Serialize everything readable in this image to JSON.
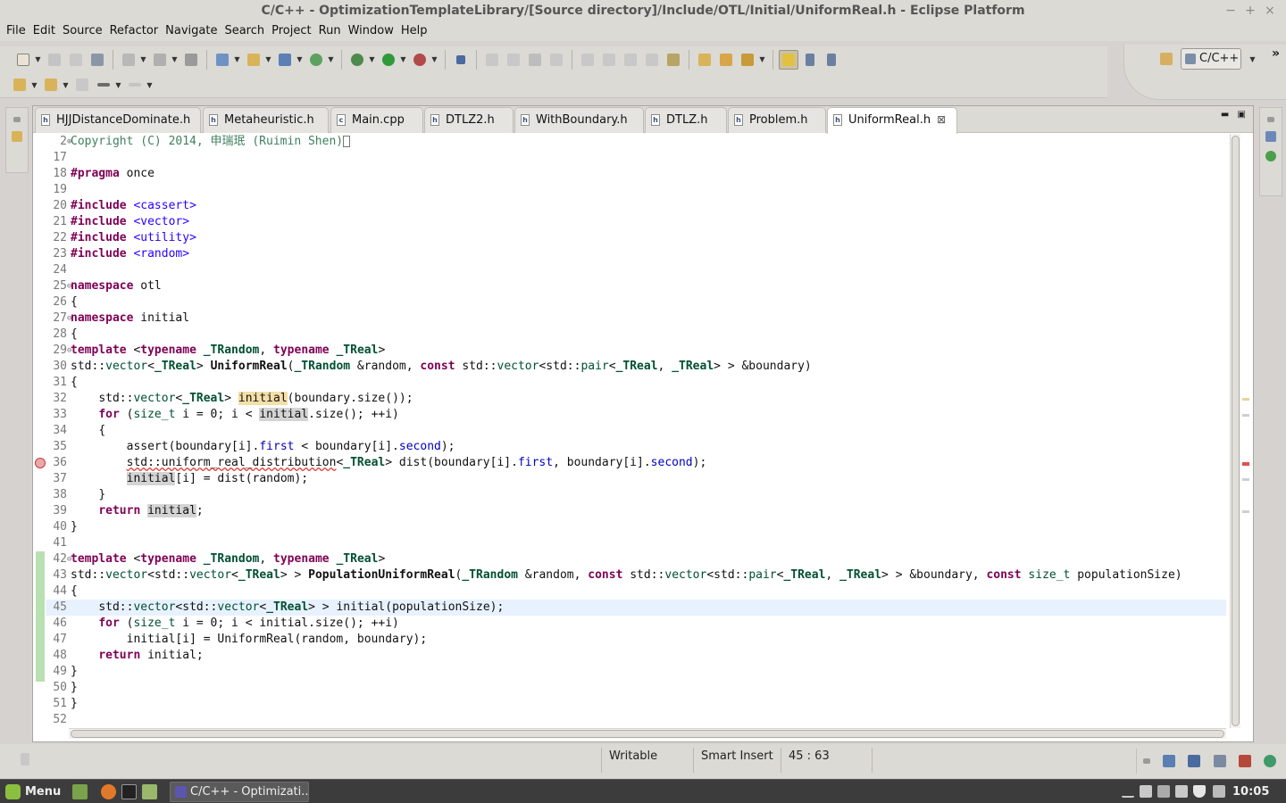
{
  "window": {
    "title": "C/C++ - OptimizationTemplateLibrary/[Source directory]/Include/OTL/Initial/UniformReal.h - Eclipse Platform"
  },
  "menubar": [
    "File",
    "Edit",
    "Source",
    "Refactor",
    "Navigate",
    "Search",
    "Project",
    "Run",
    "Window",
    "Help"
  ],
  "perspective": {
    "label": "C/C++"
  },
  "tabs": [
    {
      "label": "HJJDistanceDominate.h",
      "icon": "h"
    },
    {
      "label": "Metaheuristic.h",
      "icon": "h"
    },
    {
      "label": "Main.cpp",
      "icon": "c"
    },
    {
      "label": "DTLZ2.h",
      "icon": "h"
    },
    {
      "label": "WithBoundary.h",
      "icon": "h"
    },
    {
      "label": "DTLZ.h",
      "icon": "h"
    },
    {
      "label": "Problem.h",
      "icon": "h"
    },
    {
      "label": "UniformReal.h",
      "icon": "h",
      "active": true
    }
  ],
  "editor": {
    "line_numbers": [
      "2",
      "17",
      "18",
      "19",
      "20",
      "21",
      "22",
      "23",
      "24",
      "25",
      "26",
      "27",
      "28",
      "29",
      "30",
      "31",
      "32",
      "33",
      "34",
      "35",
      "36",
      "37",
      "38",
      "39",
      "40",
      "41",
      "42",
      "43",
      "44",
      "45",
      "46",
      "47",
      "48",
      "49",
      "50",
      "51",
      "52"
    ],
    "code": {
      "l2_comment": "Copyright (C) 2014, 申瑞珉 (Ruimin Shen)",
      "l18_kw": "#pragma",
      "l18_rest": " once",
      "include_kw": "#include",
      "inc1": "<cassert>",
      "inc2": "<vector>",
      "inc3": "<utility>",
      "inc4": "<random>",
      "namespace_kw": "namespace",
      "ns_otl": " otl",
      "ns_initial": " initial",
      "brace_open": "{",
      "brace_close": "}",
      "template_kw": "template",
      "typename_kw": "typename",
      "trandom": "_TRandom",
      "treal": "_TReal",
      "std": "std::",
      "vector": "vector",
      "pair": "pair",
      "const_kw": "const",
      "size_t": "size_t",
      "for_kw": "for",
      "return_kw": "return",
      "fn_uniform": "UniformReal",
      "fn_population": "PopulationUniformReal",
      "initial": "initial",
      "first": "first",
      "second": "second",
      "uniform_dist": "std::uniform_real_distribution",
      "args1": " &random, ",
      "args_boundary": "> > &boundary)",
      "args_boundary2": "> > &boundary, ",
      "pop_size_param": " populationSize)",
      "l32_rest": "(boundary.size());",
      "l33_mid": " i = 0; i < ",
      "l33_end": ".size(); ++i)",
      "l35_a": "assert(boundary[i].",
      "l35_b": " < boundary[i].",
      "l35_c": ");",
      "l36_a": "> dist(boundary[i].",
      "l36_b": ", boundary[i].",
      "l36_c": ");",
      "l37_rest": "[i] = dist(random);",
      "l39_end": ";",
      "l45_rest": "> > initial(populationSize);",
      "l46_rest": " i = 0; i < initial.size(); ++i)",
      "l47_text": "initial[i] = UniformReal(random, boundary);",
      "l48_rest": " initial;"
    }
  },
  "status": {
    "writable": "Writable",
    "insert_mode": "Smart Insert",
    "position": "45 : 63"
  },
  "taskbar": {
    "menu": "Menu",
    "task": "C/C++ - Optimizati...",
    "clock": "10:05"
  },
  "colors": {
    "keyword": "#7f0055",
    "include_path": "#2a00ff",
    "comment": "#3f7f5f",
    "field": "#0000c0",
    "current_line": "#e8f2fe"
  }
}
